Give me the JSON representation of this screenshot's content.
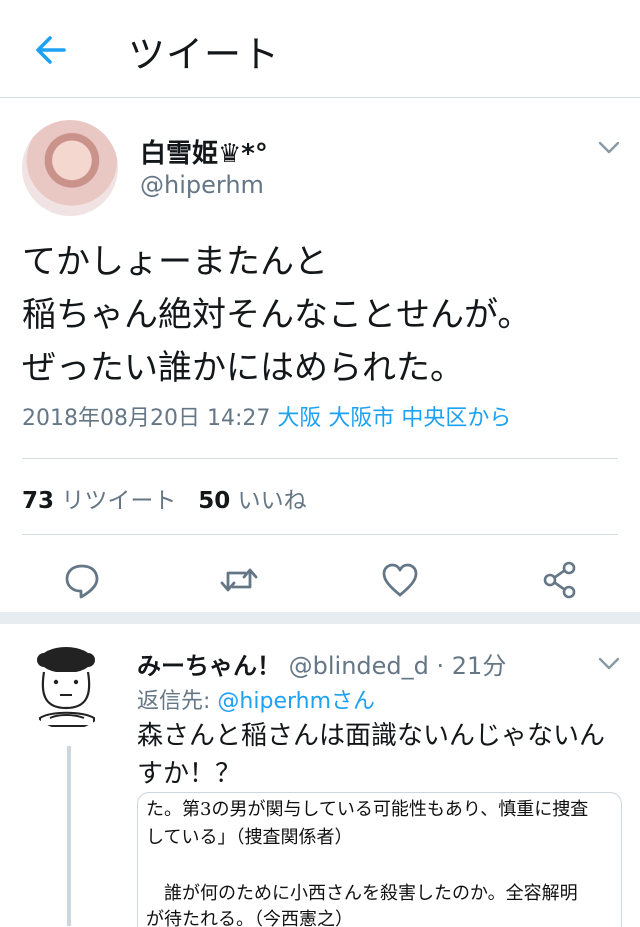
{
  "header": {
    "title": "ツイート",
    "back_icon": "arrow-left-icon",
    "accent": "#1da1f2"
  },
  "tweet": {
    "display_name": "白雪姫♛*°",
    "handle": "@hiperhm",
    "text_lines": [
      "てかしょーまたんと",
      "稲ちゃん絶対そんなことせんが。",
      "ぜったい誰かにはめられた。"
    ],
    "timestamp": "2018年08月20日 14:27",
    "location": "大阪 大阪市 中央区から",
    "retweet_count": "73",
    "retweet_label": "リツイート",
    "like_count": "50",
    "like_label": "いいね",
    "action_icons": [
      "reply-icon",
      "retweet-icon",
      "like-icon",
      "share-icon"
    ]
  },
  "reply": {
    "display_name": "みーちゃん！",
    "handle_time": "@blinded_d · 21分",
    "reply_to_label": "返信先:",
    "reply_to_handle": "@hiperhmさん",
    "text": "森さんと稲さんは面識ないんじゃないんすか！？",
    "quoted_image_lines": [
      "た。第3の男が関与している可能性もあり、慎重に捜査",
      "している」（捜査関係者）",
      "誰が何のために小西さんを殺害したのか。全容解明",
      "が待たれる。（今西憲之）"
    ]
  }
}
